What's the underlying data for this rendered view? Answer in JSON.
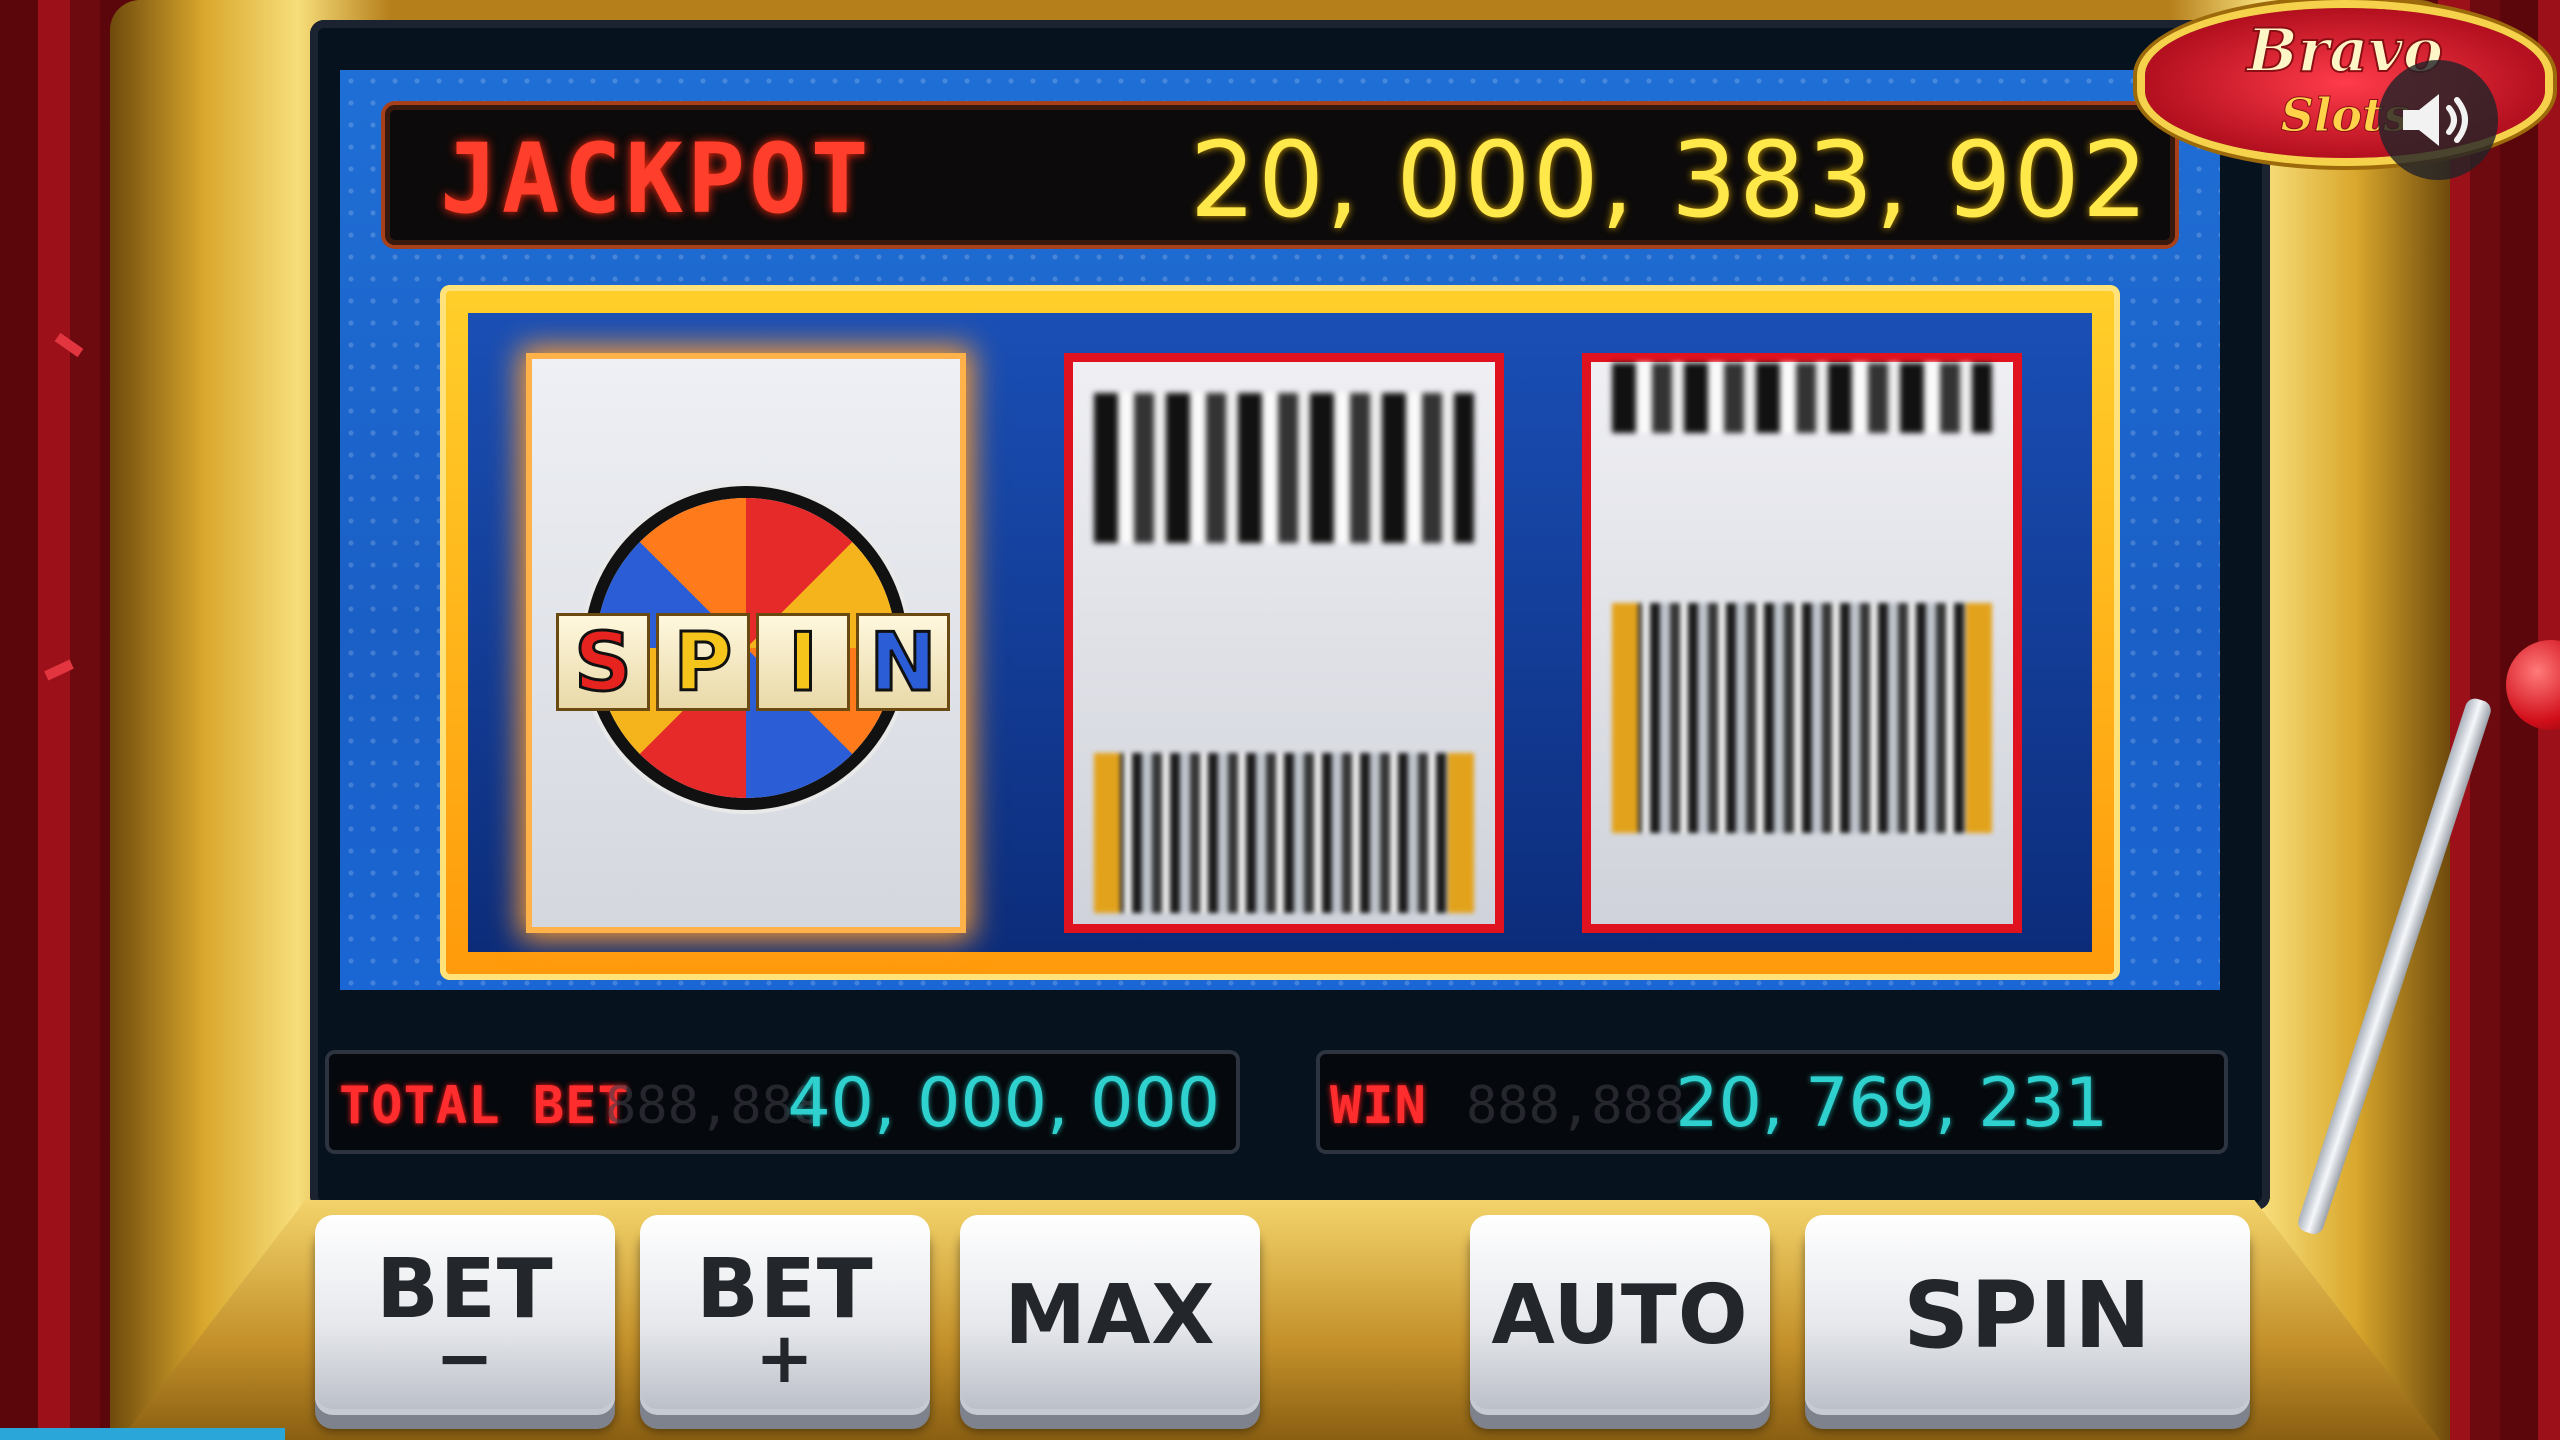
{
  "jackpot": {
    "label": "JACKPOT",
    "value": "20, 000, 383, 902"
  },
  "reels": {
    "reel1": {
      "symbol_text": [
        "S",
        "P",
        "I",
        "N"
      ]
    }
  },
  "meters": {
    "total_bet": {
      "label": "TOTAL BET",
      "value": "40, 000, 000"
    },
    "win": {
      "label": "WIN",
      "value": "20, 769, 231"
    }
  },
  "buttons": {
    "bet_minus": {
      "label": "BET",
      "sub": "−"
    },
    "bet_plus": {
      "label": "BET",
      "sub": "+"
    },
    "max": {
      "label": "MAX"
    },
    "auto": {
      "label": "AUTO"
    },
    "spin": {
      "label": "SPIN"
    }
  },
  "logo": {
    "line1": "Bravo",
    "line2": "Slots"
  },
  "icons": {
    "sound": "speaker-icon",
    "lever": "lever-icon",
    "spin_wheel": "wheel-icon"
  },
  "colors": {
    "jackpot_label": "#ff3e2b",
    "jackpot_value": "#ffe84a",
    "meter_value": "#2fd1cf",
    "reel_border": "#e0121f",
    "frame_gold": "#ffb31a"
  }
}
